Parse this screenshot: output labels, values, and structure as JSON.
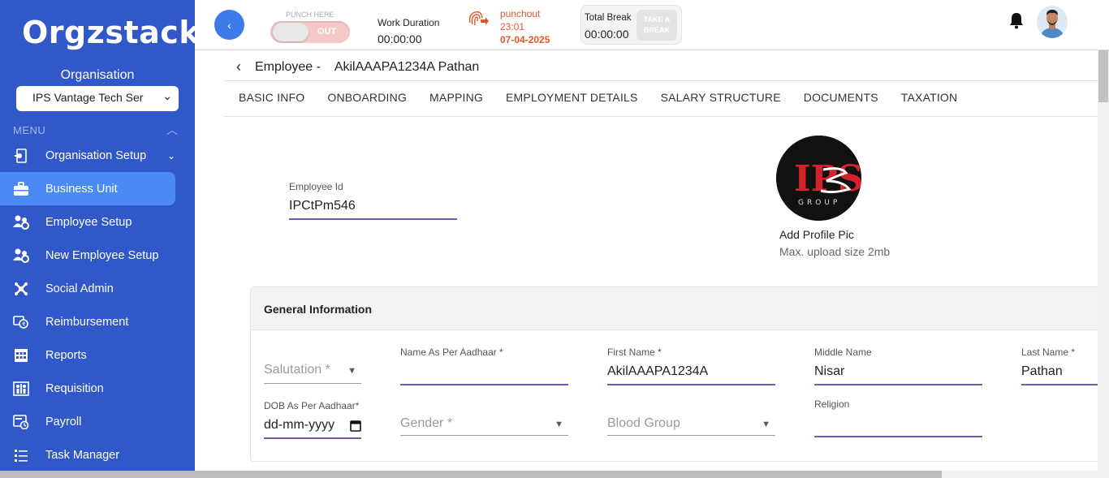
{
  "app": {
    "logo_text": "Orgzstack"
  },
  "sidebar": {
    "org_label": "Organisation",
    "org_selected": "IPS Vantage Tech Ser",
    "menu_label": "MENU",
    "items": [
      {
        "label": "Organisation Setup",
        "icon": "org-setup-icon"
      },
      {
        "label": "Business Unit",
        "icon": "briefcase-icon",
        "active": true
      },
      {
        "label": "Employee Setup",
        "icon": "users-gear-icon"
      },
      {
        "label": "New Employee Setup",
        "icon": "users-gear-icon"
      },
      {
        "label": "Social Admin",
        "icon": "social-icon"
      },
      {
        "label": "Reimbursement",
        "icon": "reimbursement-icon"
      },
      {
        "label": "Reports",
        "icon": "reports-icon"
      },
      {
        "label": "Requisition",
        "icon": "requisition-icon"
      },
      {
        "label": "Payroll",
        "icon": "payroll-icon"
      },
      {
        "label": "Task Manager",
        "icon": "task-icon"
      }
    ]
  },
  "topbar": {
    "punch_here": "PUNCH HERE",
    "punch_state": "OUT",
    "work_duration_label": "Work Duration",
    "work_duration_value": "00:00:00",
    "punchout_label": "punchout",
    "punchout_time": "23:01",
    "punchout_date": "07-04-2025",
    "total_break_label": "Total Break",
    "total_break_value": "00:00:00",
    "take_break_label": "TAKE A BREAK"
  },
  "page": {
    "breadcrumb": "Employee -    AkilAAAPA1234A Pathan",
    "tabs": [
      "BASIC INFO",
      "ONBOARDING",
      "MAPPING",
      "EMPLOYMENT DETAILS",
      "SALARY STRUCTURE",
      "DOCUMENTS",
      "TAXATION"
    ],
    "employee_id_label": "Employee Id",
    "employee_id_value": "IPCtPm546",
    "add_profile_pic": "Add Profile Pic",
    "max_upload": "Max. upload size 2mb",
    "profile_logo_text": "IPS",
    "profile_logo_sub": "GROUP"
  },
  "general_info": {
    "title": "General Information",
    "salutation_placeholder": "Salutation *",
    "name_aadhaar_label": "Name As Per Aadhaar *",
    "name_aadhaar_value": "",
    "first_name_label": "First Name *",
    "first_name_value": "AkilAAAPA1234A",
    "middle_name_label": "Middle Name",
    "middle_name_value": "Nisar",
    "last_name_label": "Last Name *",
    "last_name_value": "Pathan",
    "dob_label": "DOB As Per Aadhaar*",
    "dob_value": "dd-mm-yyyy",
    "gender_placeholder": "Gender *",
    "blood_group_placeholder": "Blood Group",
    "religion_label": "Religion",
    "religion_value": ""
  },
  "colors": {
    "sidebar_bg": "#3158c9",
    "active_item": "#4a8af4",
    "field_underline": "#7b57a8",
    "punchout_orange": "#e2572a"
  }
}
